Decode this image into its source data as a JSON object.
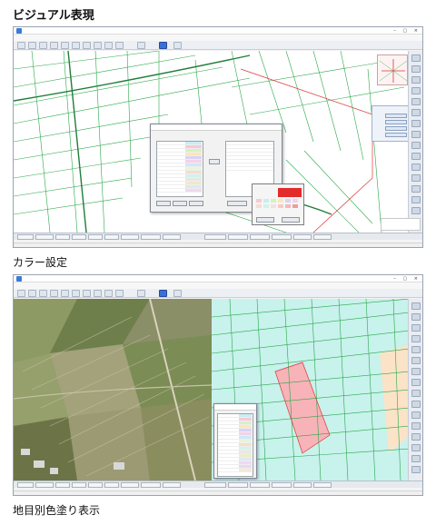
{
  "sections": {
    "visual_heading": "ビジュアル表現",
    "color_setting_caption": "カラー設定",
    "land_category_caption": "地目別色塗り表示"
  },
  "colors": {
    "parcel_line": "#2aa84a",
    "road_line": "#1f7d3a",
    "boundary_red": "#e0353a",
    "parcel_fill": "#c8f2ec",
    "highlight_fill": "#f7b3b8",
    "dialog_blue": "#3b6fd8",
    "palette_red": "#e32b2b"
  },
  "icons": {
    "app": "app-icon",
    "window_controls": "window-controls-icon",
    "toolbar_buttons": "toolbar-button-icon",
    "side_buttons": "side-tool-icon",
    "minimap": "minimap-icon"
  }
}
